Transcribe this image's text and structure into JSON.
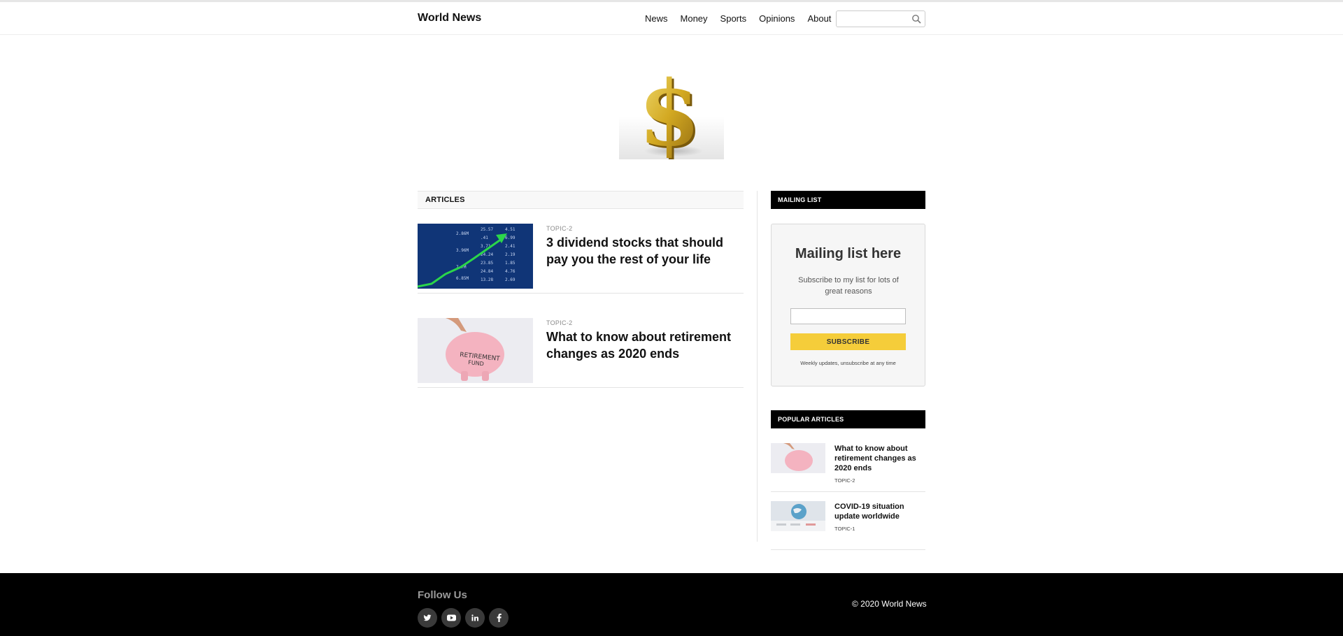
{
  "header": {
    "brand": "World News",
    "nav": [
      "News",
      "Money",
      "Sports",
      "Opinions",
      "About"
    ],
    "search_placeholder": "",
    "search_icon": "search-icon"
  },
  "hero": {
    "image": "gold-dollar-sign"
  },
  "articles": {
    "heading": "ARTICLES",
    "items": [
      {
        "topic": "TOPIC-2",
        "title": "3 dividend stocks that should pay you the rest of your life",
        "image": "stock-chart-green-arrow"
      },
      {
        "topic": "TOPIC-2",
        "title": "What to know about retirement changes as 2020 ends",
        "image": "piggy-bank-retirement-fund"
      }
    ]
  },
  "mailing": {
    "heading": "MAILING LIST",
    "title": "Mailing list here",
    "description": "Subscribe to my list for lots of great reasons",
    "email_placeholder": "",
    "button": "SUBSCRIBE",
    "note": "Weekly updates, unsubscribe at any time"
  },
  "popular": {
    "heading": "POPULAR ARTICLES",
    "items": [
      {
        "title": "What to know about retirement changes as 2020 ends",
        "topic": "TOPIC-2",
        "image": "piggy-bank-retirement-fund"
      },
      {
        "title": "COVID-19 situation update worldwide",
        "topic": "TOPIC-1",
        "image": "covid-globe-map"
      }
    ]
  },
  "footer": {
    "follow": "Follow Us",
    "socials": [
      "twitter-icon",
      "youtube-icon",
      "linkedin-icon",
      "facebook-icon"
    ],
    "copyright": "© 2020 World News"
  },
  "colors": {
    "accent": "#f5cd3a",
    "footer_bg": "#000000",
    "sidebar_head_bg": "#000000"
  }
}
